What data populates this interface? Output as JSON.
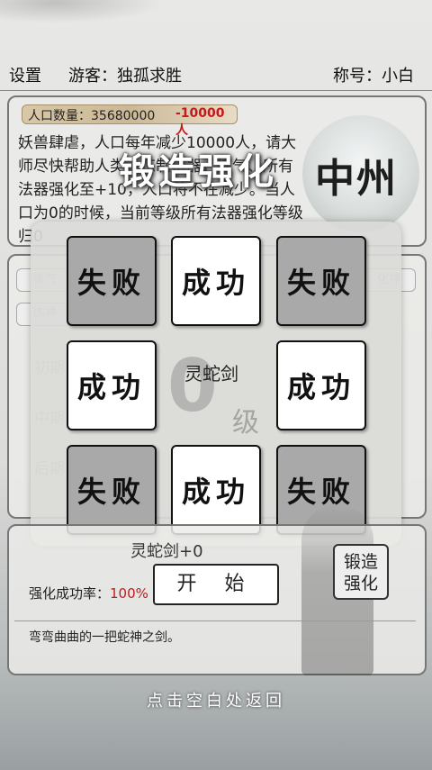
{
  "topbar": {
    "settings": "设置",
    "guest": "游客：独孤求胜",
    "title": "称号：小白"
  },
  "population": {
    "label": "人口数量：35680000",
    "delta": "-10000人"
  },
  "intro": "妖兽肆虐，人口每年减少10000人，请大师尽快帮助人类。炼制法器，炼气、所有法器强化至+10，人口将不在减少。当人口为0的时候，当前等级所有法器强化等级归0",
  "region": "中州",
  "forge_title": "锻造强化",
  "dim_buttons": [
    "练气",
    "练神",
    "初期",
    "中期",
    "后期",
    "化神"
  ],
  "weapon": {
    "name": "灵蛇剑",
    "level_big": "0",
    "level_unit": "级",
    "name_plus": "灵蛇剑+0"
  },
  "cards": [
    "失败",
    "成功",
    "失败",
    "成功",
    "成功",
    "失败",
    "成功",
    "失败"
  ],
  "rate": {
    "label": "强化成功率：",
    "value": "100%"
  },
  "start_label": "开 始",
  "forge_button": "锻造\n强化",
  "description": "弯弯曲曲的一把蛇神之剑。",
  "hint": "点击空白处返回"
}
